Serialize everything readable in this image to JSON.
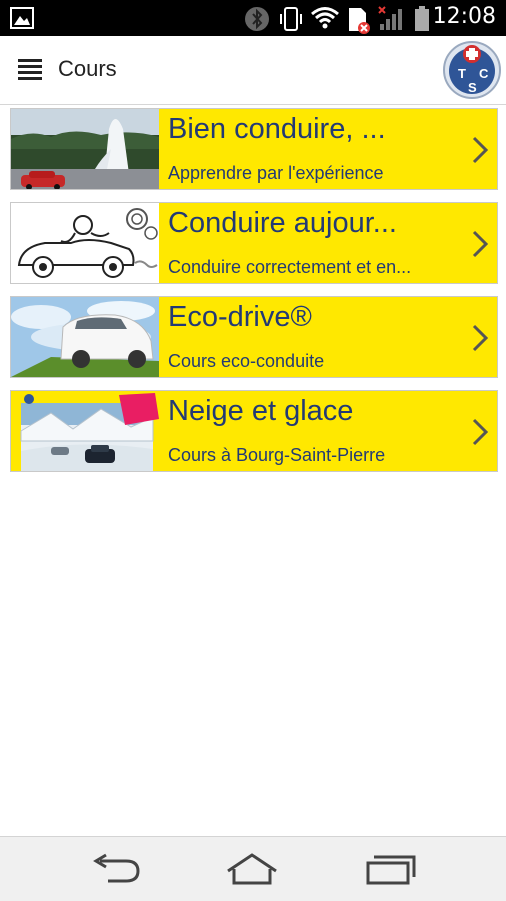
{
  "status_bar": {
    "time": "12:08",
    "icons": [
      "gallery-icon",
      "bluetooth-icon",
      "vibrate-icon",
      "wifi-icon",
      "sim-error-icon",
      "signal-icon",
      "battery-icon"
    ]
  },
  "action_bar": {
    "title": "Cours",
    "logo_letters": [
      "T",
      "C",
      "S"
    ]
  },
  "courses": [
    {
      "title": "Bien conduire, ...",
      "subtitle": "Apprendre par l'expérience",
      "thumb": "geyser-car-photo"
    },
    {
      "title": "Conduire aujour...",
      "subtitle": "Conduire correctement et en...",
      "thumb": "cartoon-driver-sketch"
    },
    {
      "title": "Eco-drive®",
      "subtitle": "Cours eco-conduite",
      "thumb": "white-car-sky-photo"
    },
    {
      "title": "Neige et glace",
      "subtitle": "Cours à Bourg-Saint-Pierre",
      "thumb": "snow-mountain-car-photo"
    }
  ],
  "colors": {
    "item_bg": "#ffe800",
    "item_text": "#233a75",
    "chevron": "#555555"
  },
  "nav_bar": {
    "buttons": [
      "back-icon",
      "home-icon",
      "recent-apps-icon"
    ]
  }
}
